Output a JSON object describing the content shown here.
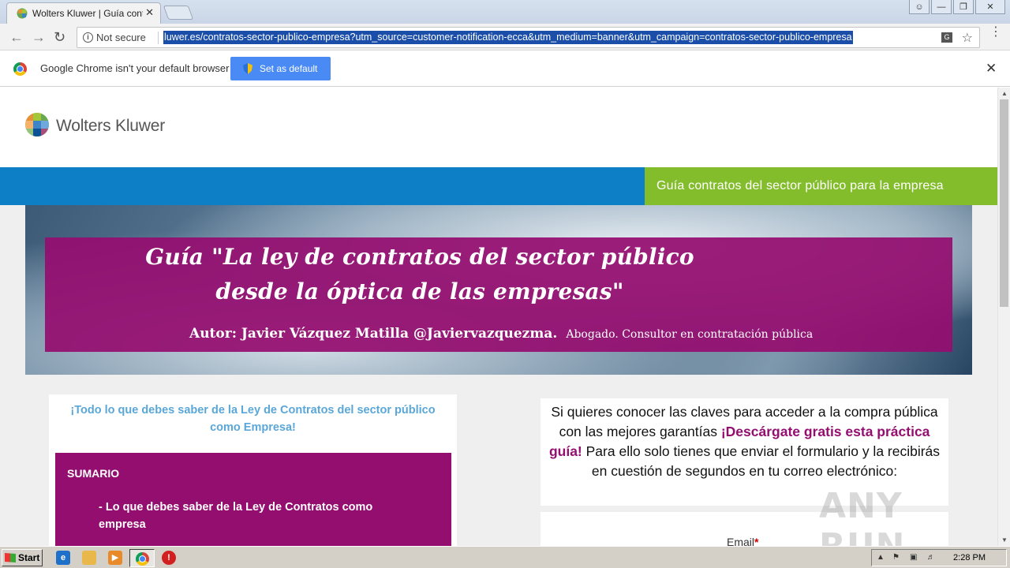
{
  "browser": {
    "tab_title": "Wolters Kluwer | Guía contr",
    "tab_close": "✕",
    "security_label": "Not secure",
    "url": "luwer.es/contratos-sector-publico-empresa?utm_source=customer-notification-ecca&utm_medium=banner&utm_campaign=contratos-sector-publico-empresa",
    "icons": [
      "back-icon",
      "forward-icon",
      "reload-icon",
      "info-icon",
      "translate-icon",
      "star-icon",
      "menu-icon"
    ]
  },
  "infobar": {
    "message": "Google Chrome isn't your default browser",
    "button_label": "Set as default",
    "close_label": "✕"
  },
  "site": {
    "logo_text": "Wolters Kluwer",
    "nav_tab": "Guía contratos del sector público para la empresa",
    "hero": {
      "title_line1": "Guía \"La ley de contratos del sector público",
      "title_line2": "desde la óptica de las empresas\"",
      "author_strong": "Autor: Javier Vázquez Matilla @Javiervazquezma.",
      "author_small": "Abogado. Consultor en contratación pública"
    },
    "left_card": {
      "heading": "¡Todo lo que debes saber de la Ley de Contratos del sector público como Empresa!",
      "sumario_title": "SUMARIO",
      "sumario_item": "- Lo que debes saber de la Ley de Contratos como empresa"
    },
    "right_card": {
      "text_before": "Si quieres conocer las claves para acceder a la compra pública con las mejores garantías ",
      "text_accent": "¡Descárgate gratis esta práctica guía!",
      "text_after": " Para ello solo tienes que enviar el formulario y la recibirás en cuestión de segundos en tu correo electrónico:",
      "email_label": "Email",
      "required_mark": "*"
    },
    "colors": {
      "blue_bar": "#0d7fc6",
      "green_tab": "#84bd2c",
      "magenta": "#940e70",
      "heading_blue": "#5aa7d8"
    }
  },
  "watermark": "ANY RUN",
  "taskbar": {
    "start_label": "Start",
    "clock": "2:28 PM"
  }
}
